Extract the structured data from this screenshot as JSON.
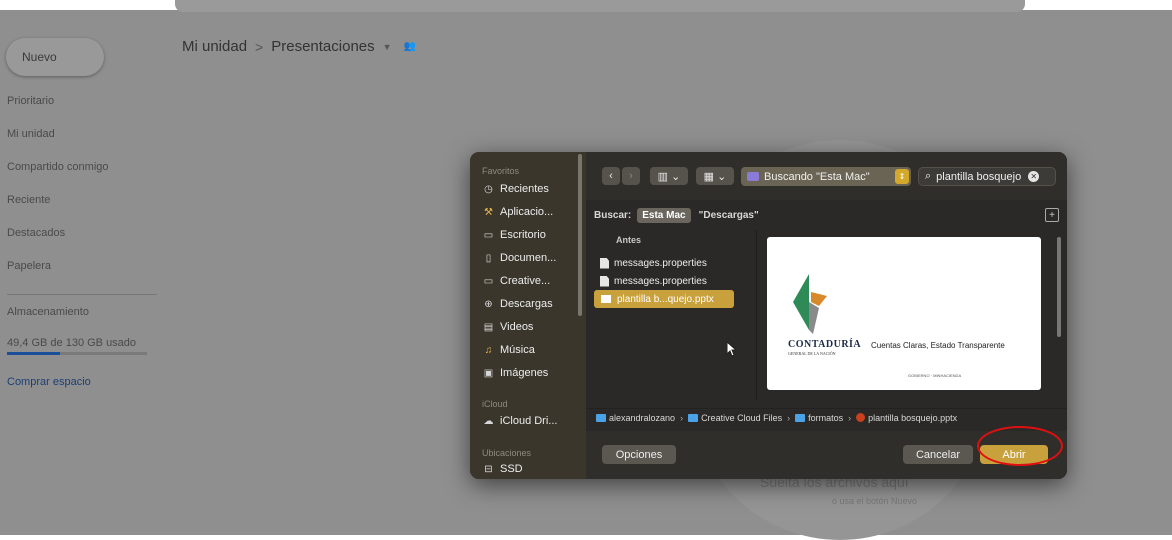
{
  "drive": {
    "new_label": "Nuevo",
    "nav": [
      "Prioritario",
      "Mi unidad",
      "Compartido conmigo",
      "Reciente",
      "Destacados",
      "Papelera"
    ],
    "storage_title": "Almacenamiento",
    "storage_used": "49,4 GB de 130 GB usado",
    "storage_fraction": 0.38,
    "buy_storage": "Comprar espacio",
    "breadcrumb_root": "Mi unidad",
    "breadcrumb_sep": ">",
    "breadcrumb_folder": "Presentaciones",
    "drop_text": "Suelta los archivos aquí",
    "drop_sub": "o usa el botón Nuevo"
  },
  "dialog": {
    "sidebar": {
      "favorites_title": "Favoritos",
      "favorites": [
        {
          "label": "Recientes",
          "icon": "clock-icon"
        },
        {
          "label": "Aplicacio...",
          "icon": "apps-icon"
        },
        {
          "label": "Escritorio",
          "icon": "desktop-icon"
        },
        {
          "label": "Documen...",
          "icon": "document-icon"
        },
        {
          "label": "Creative...",
          "icon": "folder-icon"
        },
        {
          "label": "Descargas",
          "icon": "download-icon"
        },
        {
          "label": "Videos",
          "icon": "film-icon"
        },
        {
          "label": "Música",
          "icon": "music-icon"
        },
        {
          "label": "Imágenes",
          "icon": "photo-icon"
        }
      ],
      "icloud_title": "iCloud",
      "icloud_item": "iCloud Dri...",
      "locations_title": "Ubicaciones",
      "locations_item": "SSD"
    },
    "location_popup": "Buscando \"Esta Mac\"",
    "search_value": "plantilla bosquejo",
    "scope": {
      "label": "Buscar:",
      "active": "Esta Mac",
      "other": "\"Descargas\""
    },
    "column_header": "Antes",
    "files": [
      {
        "name": "messages.properties",
        "selected": false
      },
      {
        "name": "messages.properties",
        "selected": false
      },
      {
        "name": "plantilla b...quejo.pptx",
        "selected": true
      }
    ],
    "preview": {
      "brand": "CONTADURÍA",
      "brand_sub": "GENERAL DE LA NACIÓN",
      "tagline": "Cuentas Claras, Estado Transparente",
      "footer": "GOBIERNO  ·  MINHACIENDA"
    },
    "path": [
      "alexandralozano",
      "Creative Cloud Files",
      "formatos",
      "plantilla bosquejo.pptx"
    ],
    "path_sep": "›",
    "options_label": "Opciones",
    "cancel_label": "Cancelar",
    "open_label": "Abrir"
  },
  "colors": {
    "accent": "#c9a13c",
    "highlight": "#e01010"
  }
}
